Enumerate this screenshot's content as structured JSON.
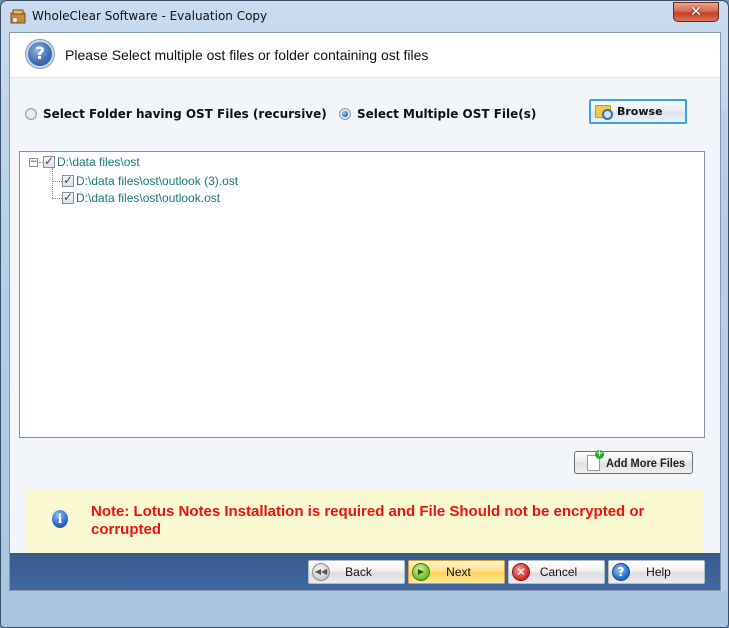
{
  "window": {
    "title": "WholeClear Software - Evaluation Copy",
    "close_label": "✕"
  },
  "header": {
    "icon": "question-icon",
    "text": "Please Select multiple ost files or folder containing ost files"
  },
  "selection_mode": {
    "options": [
      {
        "label": "Select Folder having OST Files (recursive)",
        "checked": false
      },
      {
        "label": "Select Multiple OST File(s)",
        "checked": true
      }
    ],
    "browse_label": "Browse"
  },
  "tree": {
    "root": {
      "label": "D:\\data files\\ost",
      "checked": true,
      "expanded": true
    },
    "children": [
      {
        "label": "D:\\data files\\ost\\outlook (3).ost",
        "checked": true
      },
      {
        "label": "D:\\data files\\ost\\outlook.ost",
        "checked": true
      }
    ],
    "expander_glyph": "−"
  },
  "add_more_files_label": "Add More Files",
  "note": {
    "icon": "info-icon",
    "icon_glyph": "i",
    "text": "Note: Lotus Notes Installation is required and File Should not be encrypted or corrupted",
    "color": "#ee1111"
  },
  "footer": {
    "buttons": [
      {
        "label": "Back",
        "icon": "back-icon",
        "glyph": "◀◀"
      },
      {
        "label": "Next",
        "icon": "next-icon",
        "glyph": "▶"
      },
      {
        "label": "Cancel",
        "icon": "cancel-icon",
        "glyph": "✕"
      },
      {
        "label": "Help",
        "icon": "help-icon",
        "glyph": "?"
      }
    ]
  }
}
